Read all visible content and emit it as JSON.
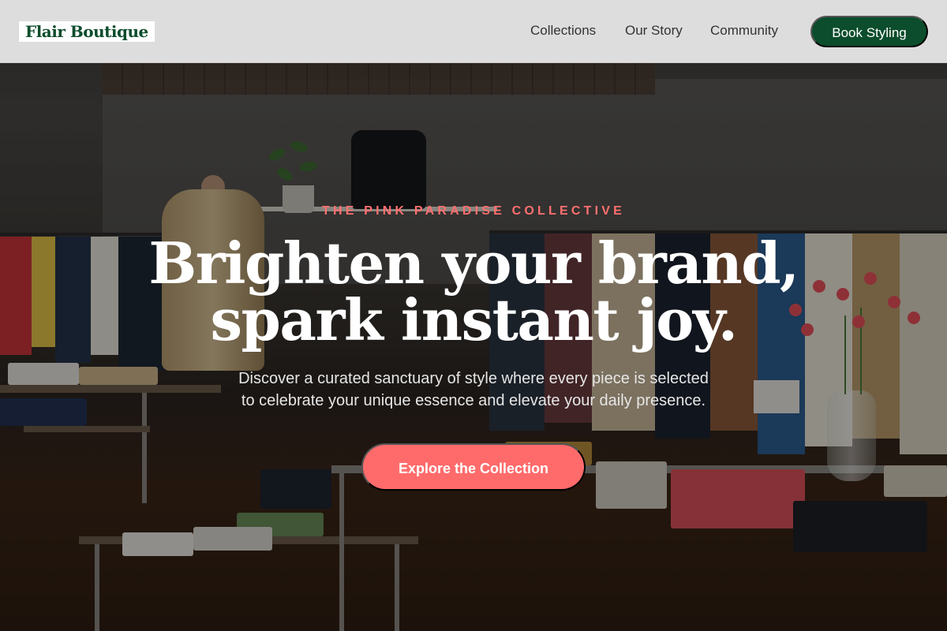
{
  "nav": {
    "logo": "Flair Boutique",
    "links": [
      "Collections",
      "Our Story",
      "Community"
    ],
    "cta": "Book Styling"
  },
  "hero": {
    "eyebrow": "THE PINK PARADISE COLLECTIVE",
    "headline_line1": "Brighten your brand,",
    "headline_line2": "spark instant joy.",
    "subtext_line1": "Discover a curated sanctuary of style where every piece is selected",
    "subtext_line2": "to celebrate your unique essence and elevate your daily presence.",
    "cta": "Explore the Collection"
  },
  "colors": {
    "brand_green": "#0b4d2c",
    "accent_coral": "#ff6b6b",
    "eyebrow_coral": "#ff6f6f"
  }
}
